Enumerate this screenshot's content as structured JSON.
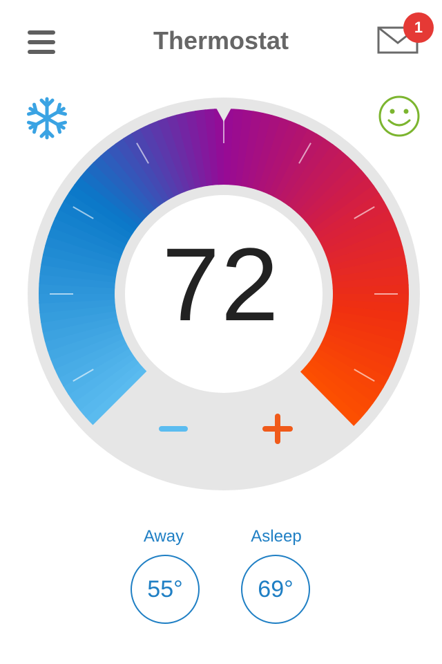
{
  "header": {
    "title": "Thermostat",
    "menu_icon": "hamburger-menu-icon",
    "mail_icon": "envelope-icon",
    "notification_count": "1"
  },
  "status_icons": {
    "mode_icon": "snowflake-icon",
    "comfort_icon": "smiley-face-icon"
  },
  "dial": {
    "current_temperature": "72",
    "decrease_icon": "minus-icon",
    "increase_icon": "plus-icon",
    "colors": {
      "cool": "#5bbcf0",
      "cool_deep": "#0a78c8",
      "mid": "#960a96",
      "warm": "#d8203c",
      "hot": "#fc5000",
      "track": "#e6e6e6"
    }
  },
  "presets": [
    {
      "label": "Away",
      "value": "55°"
    },
    {
      "label": "Asleep",
      "value": "69°"
    }
  ],
  "accent_color": "#1f7fc4"
}
